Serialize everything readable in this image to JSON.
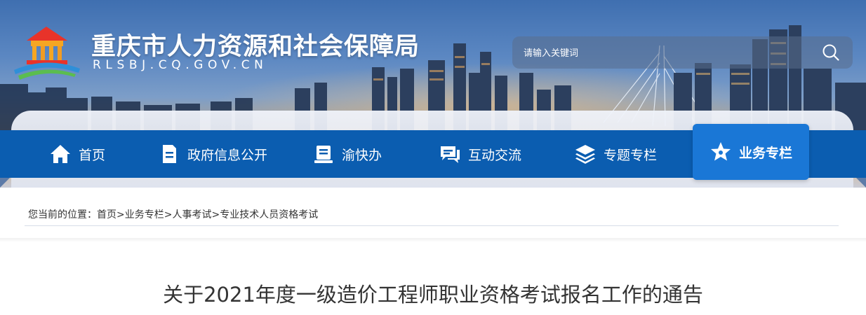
{
  "header": {
    "site_title": "重庆市人力资源和社会保障局",
    "site_domain": "RLSBJ.CQ.GOV.CN"
  },
  "search": {
    "placeholder": "请输入关键词",
    "icon": "search-icon"
  },
  "nav": {
    "items": [
      {
        "label": "首页",
        "icon": "home-icon"
      },
      {
        "label": "政府信息公开",
        "icon": "document-icon"
      },
      {
        "label": "渝快办",
        "icon": "service-icon"
      },
      {
        "label": "互动交流",
        "icon": "chat-icon"
      },
      {
        "label": "专题专栏",
        "icon": "layers-icon"
      },
      {
        "label": "业务专栏",
        "icon": "star-icon",
        "active": true
      }
    ],
    "color": "#0b5db0",
    "active_color": "#1a77d6"
  },
  "breadcrumb": {
    "prefix": "您当前的位置：",
    "items": [
      "首页",
      "业务专栏",
      "人事考试",
      "专业技术人员资格考试"
    ],
    "separator": ">"
  },
  "article": {
    "title": "关于2021年度一级造价工程师职业资格考试报名工作的通告"
  }
}
